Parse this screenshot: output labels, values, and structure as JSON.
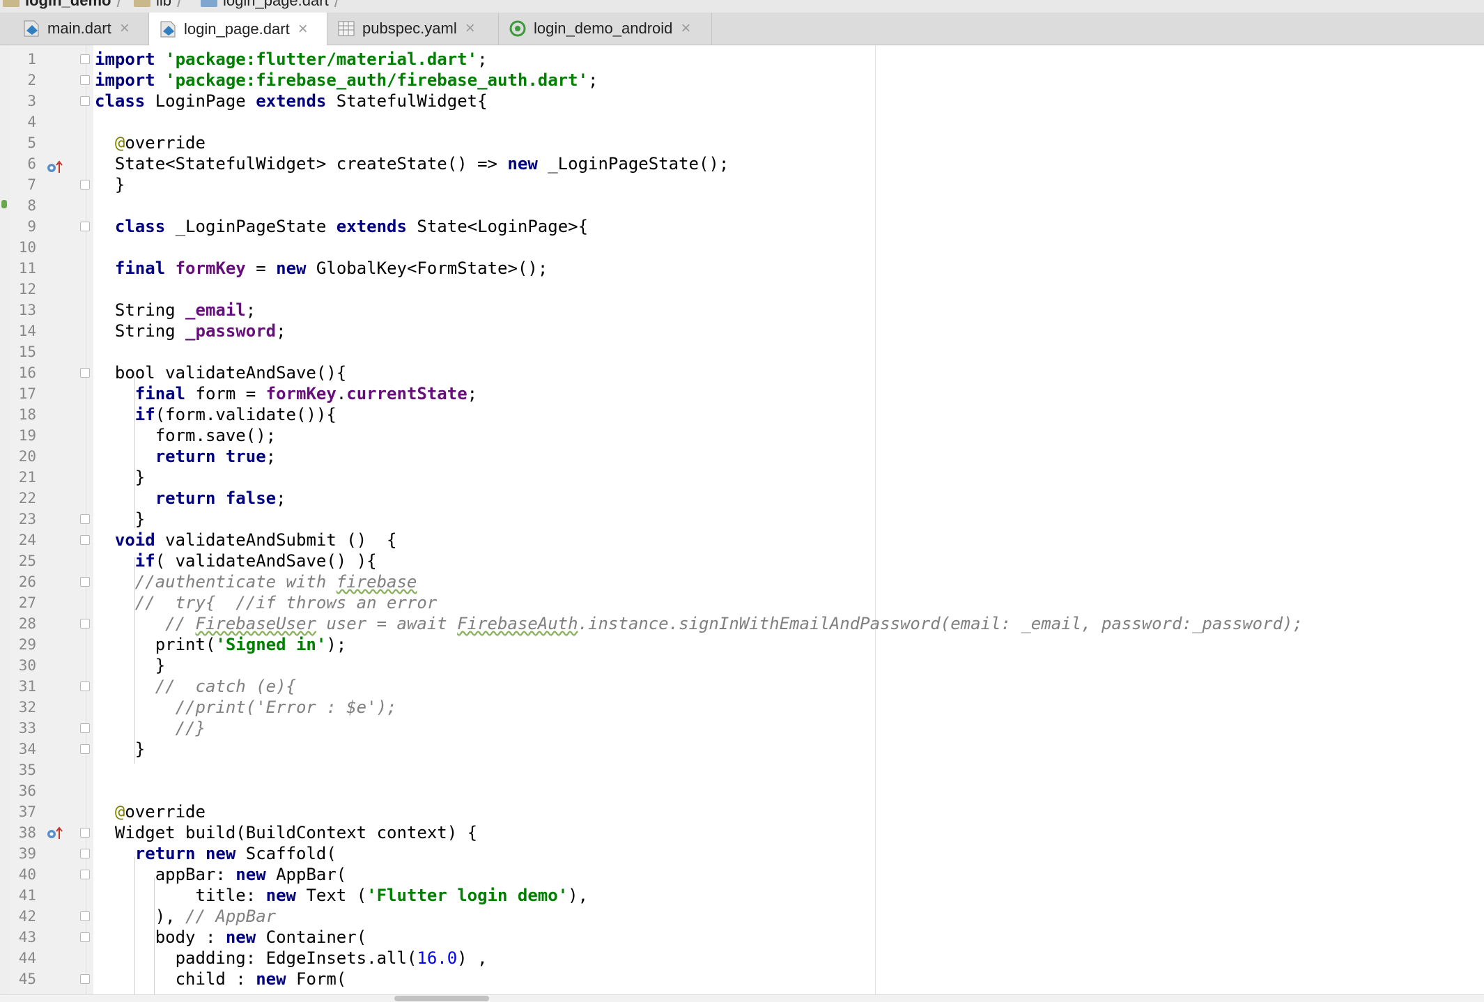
{
  "breadcrumb": {
    "items": [
      "login_demo",
      "lib",
      "login_page.dart"
    ]
  },
  "tabs": [
    {
      "label": "main.dart",
      "icon": "dart-file-icon",
      "active": false
    },
    {
      "label": "login_page.dart",
      "icon": "dart-file-icon",
      "active": true
    },
    {
      "label": "pubspec.yaml",
      "icon": "yaml-file-icon",
      "active": false
    },
    {
      "label": "login_demo_android",
      "icon": "android-module-icon",
      "active": false
    }
  ],
  "colors": {
    "keyword": "#000080",
    "string": "#008000",
    "comment": "#808080",
    "field": "#660e7a",
    "annotation": "#808000",
    "number": "#0000ff"
  },
  "line_numbers": [
    "1",
    "2",
    "3",
    "4",
    "5",
    "6",
    "7",
    "8",
    "9",
    "10",
    "11",
    "12",
    "13",
    "14",
    "15",
    "16",
    "17",
    "18",
    "19",
    "20",
    "21",
    "22",
    "23",
    "24",
    "25",
    "26",
    "27",
    "28",
    "29",
    "30",
    "31",
    "32",
    "33",
    "34",
    "35",
    "36",
    "37",
    "38",
    "39",
    "40",
    "41",
    "42",
    "43",
    "44",
    "45"
  ],
  "code": {
    "l1": [
      {
        "t": "import",
        "c": "kw"
      },
      {
        "t": " "
      },
      {
        "t": "'package:flutter/material.dart'",
        "c": "str"
      },
      {
        "t": ";"
      }
    ],
    "l2": [
      {
        "t": "import",
        "c": "kw"
      },
      {
        "t": " "
      },
      {
        "t": "'package:firebase_auth/firebase_auth.dart'",
        "c": "str"
      },
      {
        "t": ";"
      }
    ],
    "l3": [
      {
        "t": "class",
        "c": "kw"
      },
      {
        "t": " LoginPage "
      },
      {
        "t": "extends",
        "c": "kw"
      },
      {
        "t": " StatefulWidget{"
      }
    ],
    "l4": [],
    "l5": [
      {
        "t": "  "
      },
      {
        "t": "@",
        "c": "ann"
      },
      {
        "t": "override"
      }
    ],
    "l6": [
      {
        "t": "  State<StatefulWidget> createState() => "
      },
      {
        "t": "new",
        "c": "kw"
      },
      {
        "t": " _LoginPageState();"
      }
    ],
    "l7": [
      {
        "t": "  }"
      }
    ],
    "l8": [],
    "l9": [
      {
        "t": "  "
      },
      {
        "t": "class",
        "c": "kw"
      },
      {
        "t": " _LoginPageState "
      },
      {
        "t": "extends",
        "c": "kw"
      },
      {
        "t": " State<LoginPage>{"
      }
    ],
    "l10": [],
    "l11": [
      {
        "t": "  "
      },
      {
        "t": "final",
        "c": "kw"
      },
      {
        "t": " "
      },
      {
        "t": "formKey",
        "c": "fld"
      },
      {
        "t": " = "
      },
      {
        "t": "new",
        "c": "kw"
      },
      {
        "t": " GlobalKey<FormState>();"
      }
    ],
    "l12": [],
    "l13": [
      {
        "t": "  String "
      },
      {
        "t": "_email",
        "c": "fld"
      },
      {
        "t": ";"
      }
    ],
    "l14": [
      {
        "t": "  String "
      },
      {
        "t": "_password",
        "c": "fld"
      },
      {
        "t": ";"
      }
    ],
    "l15": [],
    "l16": [
      {
        "t": "  bool validateAndSave(){"
      }
    ],
    "l17": [
      {
        "t": "    "
      },
      {
        "t": "final",
        "c": "kw"
      },
      {
        "t": " form = "
      },
      {
        "t": "formKey",
        "c": "fld"
      },
      {
        "t": "."
      },
      {
        "t": "currentState",
        "c": "fld"
      },
      {
        "t": ";"
      }
    ],
    "l18": [
      {
        "t": "    "
      },
      {
        "t": "if",
        "c": "kw"
      },
      {
        "t": "(form.validate()){"
      }
    ],
    "l19": [
      {
        "t": "      form.save();"
      }
    ],
    "l20": [
      {
        "t": "      "
      },
      {
        "t": "return",
        "c": "kw"
      },
      {
        "t": " "
      },
      {
        "t": "true",
        "c": "kw"
      },
      {
        "t": ";"
      }
    ],
    "l21": [
      {
        "t": "    }"
      }
    ],
    "l22": [
      {
        "t": "      "
      },
      {
        "t": "return",
        "c": "kw"
      },
      {
        "t": " "
      },
      {
        "t": "false",
        "c": "kw"
      },
      {
        "t": ";"
      }
    ],
    "l23": [
      {
        "t": "    }"
      }
    ],
    "l24": [
      {
        "t": "  "
      },
      {
        "t": "void",
        "c": "kw"
      },
      {
        "t": " validateAndSubmit ()  {"
      }
    ],
    "l25": [
      {
        "t": "    "
      },
      {
        "t": "if",
        "c": "kw"
      },
      {
        "t": "( validateAndSave() ){"
      }
    ],
    "l26": [
      {
        "t": "    //authenticate with ",
        "c": "cm"
      },
      {
        "t": "firebase",
        "c": "cm wavy"
      }
    ],
    "l27": [
      {
        "t": "    //  try{  //if throws an error",
        "c": "cm"
      }
    ],
    "l28": [
      {
        "t": "       // ",
        "c": "cm"
      },
      {
        "t": "FirebaseUser",
        "c": "cm wavy"
      },
      {
        "t": " user = await ",
        "c": "cm"
      },
      {
        "t": "FirebaseAuth",
        "c": "cm wavy"
      },
      {
        "t": ".instance.signInWithEmailAndPassword(email: _email, password:_password);",
        "c": "cm"
      }
    ],
    "l29": [
      {
        "t": "      print("
      },
      {
        "t": "'Signed in'",
        "c": "str"
      },
      {
        "t": ");"
      }
    ],
    "l30": [
      {
        "t": "      }"
      }
    ],
    "l31": [
      {
        "t": "      //  catch (e){",
        "c": "cm"
      }
    ],
    "l32": [
      {
        "t": "        //print('Error : $e');",
        "c": "cm"
      }
    ],
    "l33": [
      {
        "t": "        //}",
        "c": "cm"
      }
    ],
    "l34": [
      {
        "t": "    }"
      }
    ],
    "l35": [],
    "l36": [],
    "l37": [
      {
        "t": "  "
      },
      {
        "t": "@",
        "c": "ann"
      },
      {
        "t": "override"
      }
    ],
    "l38": [
      {
        "t": "  Widget build(BuildContext context) {"
      }
    ],
    "l39": [
      {
        "t": "    "
      },
      {
        "t": "return",
        "c": "kw"
      },
      {
        "t": " "
      },
      {
        "t": "new",
        "c": "kw"
      },
      {
        "t": " Scaffold("
      }
    ],
    "l40": [
      {
        "t": "      appBar: "
      },
      {
        "t": "new",
        "c": "kw"
      },
      {
        "t": " AppBar("
      }
    ],
    "l41": [
      {
        "t": "          title: "
      },
      {
        "t": "new",
        "c": "kw"
      },
      {
        "t": " Text ("
      },
      {
        "t": "'Flutter login demo'",
        "c": "str"
      },
      {
        "t": "),"
      }
    ],
    "l42": [
      {
        "t": "      ), "
      },
      {
        "t": "// AppBar",
        "c": "cm"
      }
    ],
    "l43": [
      {
        "t": "      body : "
      },
      {
        "t": "new",
        "c": "kw"
      },
      {
        "t": " Container("
      }
    ],
    "l44": [
      {
        "t": "        padding: EdgeInsets.all("
      },
      {
        "t": "16.0",
        "c": "num"
      },
      {
        "t": ") ,"
      }
    ],
    "l45": [
      {
        "t": "        child : "
      },
      {
        "t": "new",
        "c": "kw"
      },
      {
        "t": " Form("
      }
    ]
  }
}
